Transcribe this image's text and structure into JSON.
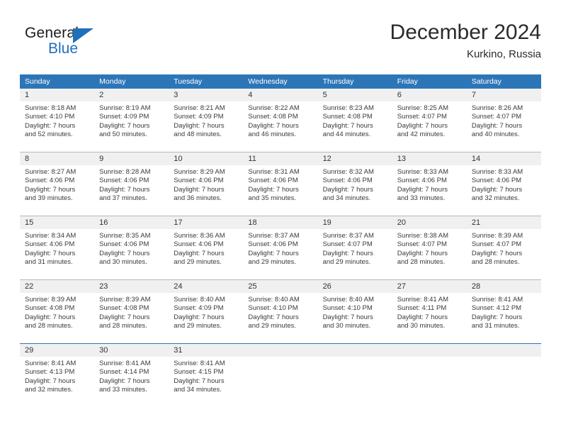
{
  "brand": {
    "name_dark": "General",
    "name_blue": "Blue",
    "accent_color": "#1f70b8"
  },
  "header": {
    "title": "December 2024",
    "subtitle": "Kurkino, Russia"
  },
  "theme": {
    "header_row_bg": "#2c76b8",
    "day_number_bg": "#f0f0f0",
    "grid_line": "#b8b8b8",
    "text": "#3a3a3a"
  },
  "weekdays": [
    "Sunday",
    "Monday",
    "Tuesday",
    "Wednesday",
    "Thursday",
    "Friday",
    "Saturday"
  ],
  "weeks": [
    [
      {
        "day": "1",
        "sunrise": "Sunrise: 8:18 AM",
        "sunset": "Sunset: 4:10 PM",
        "daylight1": "Daylight: 7 hours",
        "daylight2": "and 52 minutes."
      },
      {
        "day": "2",
        "sunrise": "Sunrise: 8:19 AM",
        "sunset": "Sunset: 4:09 PM",
        "daylight1": "Daylight: 7 hours",
        "daylight2": "and 50 minutes."
      },
      {
        "day": "3",
        "sunrise": "Sunrise: 8:21 AM",
        "sunset": "Sunset: 4:09 PM",
        "daylight1": "Daylight: 7 hours",
        "daylight2": "and 48 minutes."
      },
      {
        "day": "4",
        "sunrise": "Sunrise: 8:22 AM",
        "sunset": "Sunset: 4:08 PM",
        "daylight1": "Daylight: 7 hours",
        "daylight2": "and 46 minutes."
      },
      {
        "day": "5",
        "sunrise": "Sunrise: 8:23 AM",
        "sunset": "Sunset: 4:08 PM",
        "daylight1": "Daylight: 7 hours",
        "daylight2": "and 44 minutes."
      },
      {
        "day": "6",
        "sunrise": "Sunrise: 8:25 AM",
        "sunset": "Sunset: 4:07 PM",
        "daylight1": "Daylight: 7 hours",
        "daylight2": "and 42 minutes."
      },
      {
        "day": "7",
        "sunrise": "Sunrise: 8:26 AM",
        "sunset": "Sunset: 4:07 PM",
        "daylight1": "Daylight: 7 hours",
        "daylight2": "and 40 minutes."
      }
    ],
    [
      {
        "day": "8",
        "sunrise": "Sunrise: 8:27 AM",
        "sunset": "Sunset: 4:06 PM",
        "daylight1": "Daylight: 7 hours",
        "daylight2": "and 39 minutes."
      },
      {
        "day": "9",
        "sunrise": "Sunrise: 8:28 AM",
        "sunset": "Sunset: 4:06 PM",
        "daylight1": "Daylight: 7 hours",
        "daylight2": "and 37 minutes."
      },
      {
        "day": "10",
        "sunrise": "Sunrise: 8:29 AM",
        "sunset": "Sunset: 4:06 PM",
        "daylight1": "Daylight: 7 hours",
        "daylight2": "and 36 minutes."
      },
      {
        "day": "11",
        "sunrise": "Sunrise: 8:31 AM",
        "sunset": "Sunset: 4:06 PM",
        "daylight1": "Daylight: 7 hours",
        "daylight2": "and 35 minutes."
      },
      {
        "day": "12",
        "sunrise": "Sunrise: 8:32 AM",
        "sunset": "Sunset: 4:06 PM",
        "daylight1": "Daylight: 7 hours",
        "daylight2": "and 34 minutes."
      },
      {
        "day": "13",
        "sunrise": "Sunrise: 8:33 AM",
        "sunset": "Sunset: 4:06 PM",
        "daylight1": "Daylight: 7 hours",
        "daylight2": "and 33 minutes."
      },
      {
        "day": "14",
        "sunrise": "Sunrise: 8:33 AM",
        "sunset": "Sunset: 4:06 PM",
        "daylight1": "Daylight: 7 hours",
        "daylight2": "and 32 minutes."
      }
    ],
    [
      {
        "day": "15",
        "sunrise": "Sunrise: 8:34 AM",
        "sunset": "Sunset: 4:06 PM",
        "daylight1": "Daylight: 7 hours",
        "daylight2": "and 31 minutes."
      },
      {
        "day": "16",
        "sunrise": "Sunrise: 8:35 AM",
        "sunset": "Sunset: 4:06 PM",
        "daylight1": "Daylight: 7 hours",
        "daylight2": "and 30 minutes."
      },
      {
        "day": "17",
        "sunrise": "Sunrise: 8:36 AM",
        "sunset": "Sunset: 4:06 PM",
        "daylight1": "Daylight: 7 hours",
        "daylight2": "and 29 minutes."
      },
      {
        "day": "18",
        "sunrise": "Sunrise: 8:37 AM",
        "sunset": "Sunset: 4:06 PM",
        "daylight1": "Daylight: 7 hours",
        "daylight2": "and 29 minutes."
      },
      {
        "day": "19",
        "sunrise": "Sunrise: 8:37 AM",
        "sunset": "Sunset: 4:07 PM",
        "daylight1": "Daylight: 7 hours",
        "daylight2": "and 29 minutes."
      },
      {
        "day": "20",
        "sunrise": "Sunrise: 8:38 AM",
        "sunset": "Sunset: 4:07 PM",
        "daylight1": "Daylight: 7 hours",
        "daylight2": "and 28 minutes."
      },
      {
        "day": "21",
        "sunrise": "Sunrise: 8:39 AM",
        "sunset": "Sunset: 4:07 PM",
        "daylight1": "Daylight: 7 hours",
        "daylight2": "and 28 minutes."
      }
    ],
    [
      {
        "day": "22",
        "sunrise": "Sunrise: 8:39 AM",
        "sunset": "Sunset: 4:08 PM",
        "daylight1": "Daylight: 7 hours",
        "daylight2": "and 28 minutes."
      },
      {
        "day": "23",
        "sunrise": "Sunrise: 8:39 AM",
        "sunset": "Sunset: 4:08 PM",
        "daylight1": "Daylight: 7 hours",
        "daylight2": "and 28 minutes."
      },
      {
        "day": "24",
        "sunrise": "Sunrise: 8:40 AM",
        "sunset": "Sunset: 4:09 PM",
        "daylight1": "Daylight: 7 hours",
        "daylight2": "and 29 minutes."
      },
      {
        "day": "25",
        "sunrise": "Sunrise: 8:40 AM",
        "sunset": "Sunset: 4:10 PM",
        "daylight1": "Daylight: 7 hours",
        "daylight2": "and 29 minutes."
      },
      {
        "day": "26",
        "sunrise": "Sunrise: 8:40 AM",
        "sunset": "Sunset: 4:10 PM",
        "daylight1": "Daylight: 7 hours",
        "daylight2": "and 30 minutes."
      },
      {
        "day": "27",
        "sunrise": "Sunrise: 8:41 AM",
        "sunset": "Sunset: 4:11 PM",
        "daylight1": "Daylight: 7 hours",
        "daylight2": "and 30 minutes."
      },
      {
        "day": "28",
        "sunrise": "Sunrise: 8:41 AM",
        "sunset": "Sunset: 4:12 PM",
        "daylight1": "Daylight: 7 hours",
        "daylight2": "and 31 minutes."
      }
    ],
    [
      {
        "day": "29",
        "sunrise": "Sunrise: 8:41 AM",
        "sunset": "Sunset: 4:13 PM",
        "daylight1": "Daylight: 7 hours",
        "daylight2": "and 32 minutes."
      },
      {
        "day": "30",
        "sunrise": "Sunrise: 8:41 AM",
        "sunset": "Sunset: 4:14 PM",
        "daylight1": "Daylight: 7 hours",
        "daylight2": "and 33 minutes."
      },
      {
        "day": "31",
        "sunrise": "Sunrise: 8:41 AM",
        "sunset": "Sunset: 4:15 PM",
        "daylight1": "Daylight: 7 hours",
        "daylight2": "and 34 minutes."
      },
      {
        "day": "",
        "sunrise": "",
        "sunset": "",
        "daylight1": "",
        "daylight2": ""
      },
      {
        "day": "",
        "sunrise": "",
        "sunset": "",
        "daylight1": "",
        "daylight2": ""
      },
      {
        "day": "",
        "sunrise": "",
        "sunset": "",
        "daylight1": "",
        "daylight2": ""
      },
      {
        "day": "",
        "sunrise": "",
        "sunset": "",
        "daylight1": "",
        "daylight2": ""
      }
    ]
  ]
}
